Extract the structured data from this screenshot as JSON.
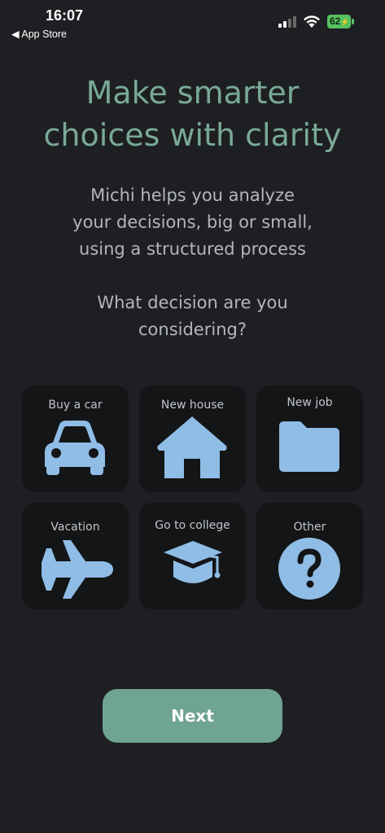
{
  "status_bar": {
    "time": "16:07",
    "back_label": "◀ App Store",
    "battery": "62"
  },
  "title": {
    "line1": "Make smarter",
    "line2": "choices with clarity"
  },
  "subtitle": {
    "line1": "Michi helps you analyze",
    "line2": "your decisions, big or small,",
    "line3": "using a structured process"
  },
  "question": {
    "line1": "What decision are you",
    "line2": "considering?"
  },
  "options": [
    {
      "label": "Buy a car",
      "icon": "car-icon"
    },
    {
      "label": "New house",
      "icon": "house-icon"
    },
    {
      "label": "New job",
      "icon": "folder-icon"
    },
    {
      "label": "Vacation",
      "icon": "airplane-icon"
    },
    {
      "label": "Go to college",
      "icon": "graduation-cap-icon"
    },
    {
      "label": "Other",
      "icon": "question-icon"
    }
  ],
  "next_button": "Next",
  "colors": {
    "background": "#1e1f22",
    "card": "#131517",
    "accent": "#79a996",
    "button": "#6fa392",
    "icon": "#8fbde6"
  }
}
